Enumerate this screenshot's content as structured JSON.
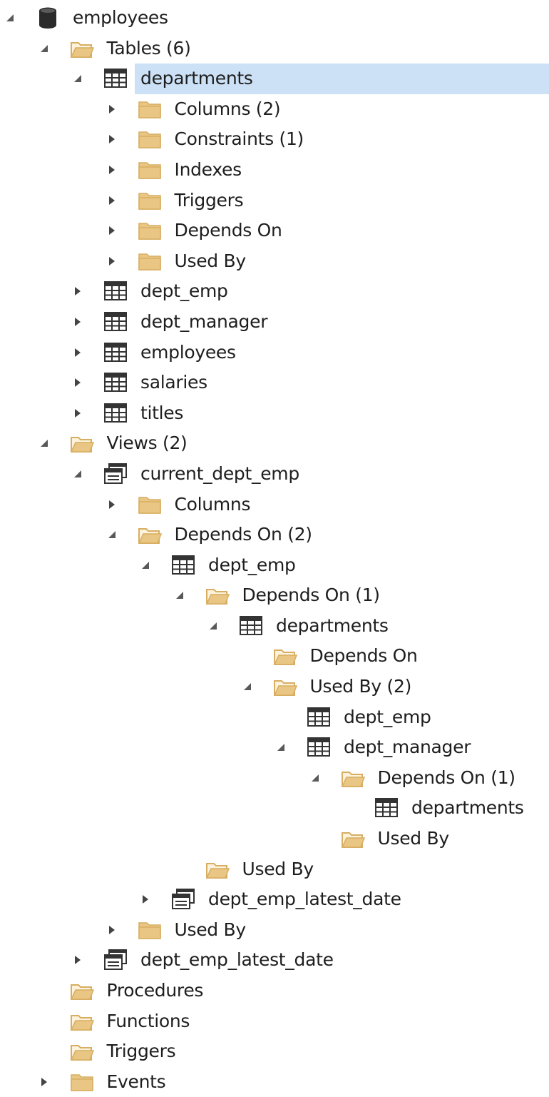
{
  "tree": [
    {
      "label": "employees",
      "icon": "database-icon",
      "arrow": "expanded",
      "level": 0
    },
    {
      "label": "Tables (6)",
      "icon": "folder-open-icon",
      "arrow": "expanded",
      "level": 1
    },
    {
      "label": "departments",
      "icon": "table-icon",
      "arrow": "expanded",
      "level": 2,
      "selected": true
    },
    {
      "label": "Columns (2)",
      "icon": "folder-icon",
      "arrow": "collapsed",
      "level": 3
    },
    {
      "label": "Constraints (1)",
      "icon": "folder-icon",
      "arrow": "collapsed",
      "level": 3
    },
    {
      "label": "Indexes",
      "icon": "folder-icon",
      "arrow": "collapsed",
      "level": 3
    },
    {
      "label": "Triggers",
      "icon": "folder-icon",
      "arrow": "collapsed",
      "level": 3
    },
    {
      "label": "Depends On",
      "icon": "folder-icon",
      "arrow": "collapsed",
      "level": 3
    },
    {
      "label": "Used By",
      "icon": "folder-icon",
      "arrow": "collapsed",
      "level": 3
    },
    {
      "label": "dept_emp",
      "icon": "table-icon",
      "arrow": "collapsed",
      "level": 2
    },
    {
      "label": "dept_manager",
      "icon": "table-icon",
      "arrow": "collapsed",
      "level": 2
    },
    {
      "label": "employees",
      "icon": "table-icon",
      "arrow": "collapsed",
      "level": 2
    },
    {
      "label": "salaries",
      "icon": "table-icon",
      "arrow": "collapsed",
      "level": 2
    },
    {
      "label": "titles",
      "icon": "table-icon",
      "arrow": "collapsed",
      "level": 2
    },
    {
      "label": "Views (2)",
      "icon": "folder-open-icon",
      "arrow": "expanded",
      "level": 1
    },
    {
      "label": "current_dept_emp",
      "icon": "view-icon",
      "arrow": "expanded",
      "level": 2
    },
    {
      "label": "Columns",
      "icon": "folder-icon",
      "arrow": "collapsed",
      "level": 3
    },
    {
      "label": "Depends On (2)",
      "icon": "folder-open-icon",
      "arrow": "expanded",
      "level": 3
    },
    {
      "label": "dept_emp",
      "icon": "table-icon",
      "arrow": "expanded",
      "level": 4
    },
    {
      "label": "Depends On (1)",
      "icon": "folder-open-icon",
      "arrow": "expanded",
      "level": 5
    },
    {
      "label": "departments",
      "icon": "table-icon",
      "arrow": "expanded",
      "level": 6
    },
    {
      "label": "Depends On",
      "icon": "folder-open-icon",
      "arrow": "none",
      "level": 7
    },
    {
      "label": "Used By (2)",
      "icon": "folder-open-icon",
      "arrow": "expanded",
      "level": 7
    },
    {
      "label": "dept_emp",
      "icon": "table-icon",
      "arrow": "none",
      "level": 8
    },
    {
      "label": "dept_manager",
      "icon": "table-icon",
      "arrow": "expanded",
      "level": 8
    },
    {
      "label": "Depends On (1)",
      "icon": "folder-open-icon",
      "arrow": "expanded",
      "level": 9
    },
    {
      "label": "departments",
      "icon": "table-icon",
      "arrow": "none",
      "level": 10
    },
    {
      "label": "Used By",
      "icon": "folder-open-icon",
      "arrow": "none",
      "level": 9
    },
    {
      "label": "Used By",
      "icon": "folder-open-icon",
      "arrow": "none",
      "level": 5
    },
    {
      "label": "dept_emp_latest_date",
      "icon": "view-icon",
      "arrow": "collapsed",
      "level": 4
    },
    {
      "label": "Used By",
      "icon": "folder-icon",
      "arrow": "collapsed",
      "level": 3
    },
    {
      "label": "dept_emp_latest_date",
      "icon": "view-icon",
      "arrow": "collapsed",
      "level": 2
    },
    {
      "label": "Procedures",
      "icon": "folder-open-icon",
      "arrow": "none",
      "level": 1
    },
    {
      "label": "Functions",
      "icon": "folder-open-icon",
      "arrow": "none",
      "level": 1
    },
    {
      "label": "Triggers",
      "icon": "folder-open-icon",
      "arrow": "none",
      "level": 1
    },
    {
      "label": "Events",
      "icon": "folder-icon",
      "arrow": "collapsed",
      "level": 1
    }
  ],
  "colors": {
    "selection": "#cce1f6",
    "folder": "#e9c683",
    "folder_dark": "#d7ae62",
    "text": "#1e1e1e",
    "arrow_expanded": "#595959",
    "arrow_collapsed": "#444444",
    "table_icon": "#333333"
  }
}
